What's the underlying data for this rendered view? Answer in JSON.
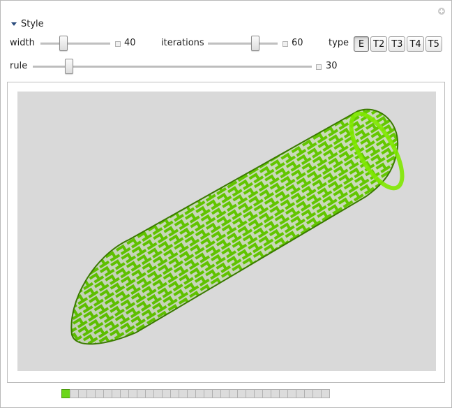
{
  "controls": {
    "style_label": "Style",
    "width": {
      "label": "width",
      "value": "40",
      "fraction": 0.33
    },
    "iterations": {
      "label": "iterations",
      "value": "60",
      "fraction": 0.68
    },
    "rule": {
      "label": "rule",
      "value": "30",
      "fraction": 0.13
    },
    "type": {
      "label": "type",
      "options": [
        "E",
        "T2",
        "T3",
        "T4",
        "T5"
      ],
      "selected": "E"
    }
  },
  "plot": {
    "background": "#d9d9d9",
    "tube_colors": [
      "#3f8f00",
      "#6fd400",
      "#86f00a"
    ]
  },
  "animation": {
    "frame_count": 32,
    "current_frame": 1
  }
}
